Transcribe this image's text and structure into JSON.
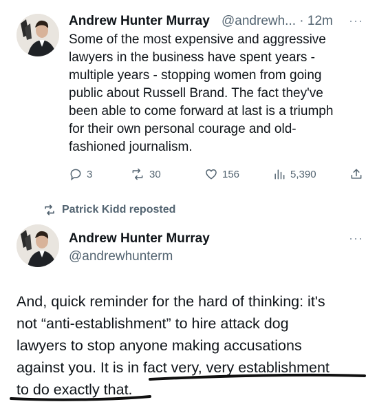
{
  "tweet1": {
    "author_name": "Andrew Hunter Murray",
    "handle_time": "@andrewh... · 12m",
    "more_label": "···",
    "text_lines": [
      "Some of the most expensive and aggressive",
      "lawyers in the business have spent years -",
      "multiple years - stopping women from going",
      "public about Russell Brand. The fact they've",
      "been able to come forward at last is a triumph",
      "for their own personal courage and old-",
      "fashioned journalism."
    ],
    "actions": {
      "replies": "3",
      "reposts": "30",
      "likes": "156",
      "views": "5,390"
    }
  },
  "repost_banner": {
    "text": "Patrick Kidd reposted"
  },
  "tweet2": {
    "author_name": "Andrew Hunter Murray",
    "handle": "@andrewhunterm",
    "more_label": "···",
    "text_lines": [
      "And, quick reminder for the hard of thinking: it's",
      "not “anti-establishment” to hire attack dog",
      "lawyers to stop anyone making accusations",
      "against you. It is in fact very, very establishment",
      "to do exactly that."
    ]
  },
  "icons": [
    "reply-icon",
    "repost-icon",
    "like-icon",
    "views-icon",
    "share-icon"
  ],
  "colors": {
    "text": "#0f1419",
    "muted": "#536471",
    "annotation_ink": "#101010"
  }
}
